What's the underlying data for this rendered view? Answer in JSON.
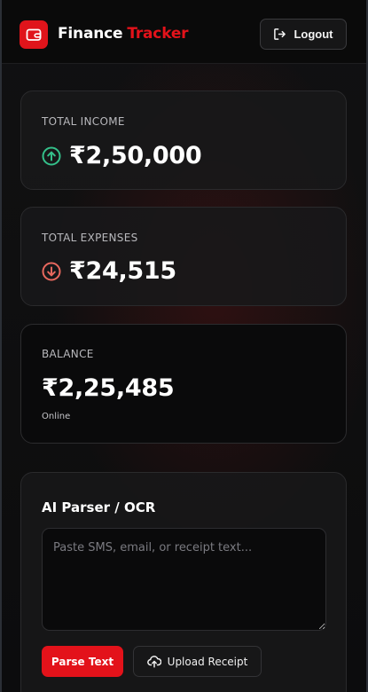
{
  "header": {
    "brand_part1": "Finance",
    "brand_part2": "Tracker",
    "logout_label": "Logout",
    "logo_icon": "wallet-icon",
    "accent_color": "#e3121a"
  },
  "summary": {
    "income": {
      "label": "TOTAL INCOME",
      "amount": "₹2,50,000",
      "icon": "arrow-up-circle-icon",
      "icon_color": "#34c08a"
    },
    "expenses": {
      "label": "TOTAL EXPENSES",
      "amount": "₹24,515",
      "icon": "arrow-down-circle-icon",
      "icon_color": "#e8685e"
    },
    "balance": {
      "label": "BALANCE",
      "amount": "₹2,25,485",
      "status": "Online"
    }
  },
  "parser": {
    "title": "AI Parser / OCR",
    "placeholder": "Paste SMS, email, or receipt text...",
    "value": "",
    "parse_label": "Parse Text",
    "upload_label": "Upload Receipt",
    "upload_icon": "cloud-upload-icon"
  }
}
